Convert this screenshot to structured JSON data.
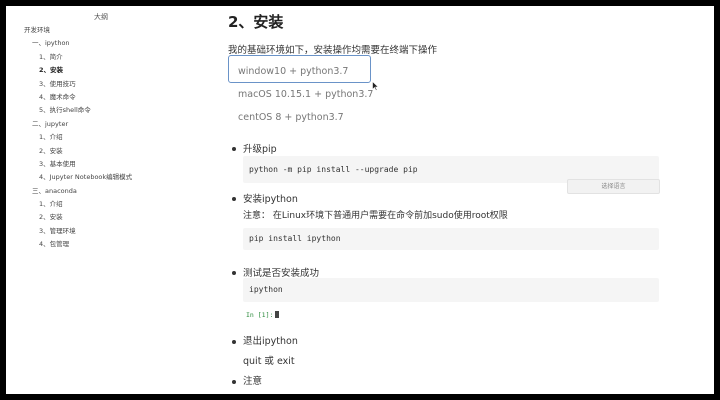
{
  "outline": {
    "title": "大纲",
    "items": [
      {
        "label": "开发环境",
        "level": 0
      },
      {
        "label": "一、ipython",
        "level": 1
      },
      {
        "label": "1、简介",
        "level": 2
      },
      {
        "label": "2、安装",
        "level": 2,
        "active": true
      },
      {
        "label": "3、使用技巧",
        "level": 2
      },
      {
        "label": "4、魔术命令",
        "level": 2
      },
      {
        "label": "5、执行shell命令",
        "level": 2
      },
      {
        "label": "二、jupyter",
        "level": 1
      },
      {
        "label": "1、介绍",
        "level": 2
      },
      {
        "label": "2、安装",
        "level": 2
      },
      {
        "label": "3、基本使用",
        "level": 2
      },
      {
        "label": "4、Jupyter Notebook编辑模式",
        "level": 2
      },
      {
        "label": "三、anaconda",
        "level": 1
      },
      {
        "label": "1、介绍",
        "level": 2
      },
      {
        "label": "2、安装",
        "level": 2
      },
      {
        "label": "3、管理环境",
        "level": 2
      },
      {
        "label": "4、包管理",
        "level": 2
      }
    ]
  },
  "content": {
    "heading": "2、安装",
    "intro": "我的基础环境如下，安装操作均需要在终端下操作",
    "envs": [
      "window10 + python3.7",
      "macOS 10.15.1 + python3.7",
      "centOS 8 + python3.7"
    ],
    "bullets": {
      "upgrade": "升级pip",
      "install": "安装ipython",
      "test": "测试是否安装成功",
      "quit": "退出ipython",
      "notice": "注意"
    },
    "code_upgrade": "python -m pip install --upgrade pip",
    "note": "注意： 在Linux环境下普通用户需要在命令前加sudo使用root权限",
    "code_install": "pip install ipython",
    "code_test": "ipython",
    "in_prompt": "In [1]:",
    "quit_cmd": "quit 或 exit",
    "lang_button": "选择语言"
  }
}
